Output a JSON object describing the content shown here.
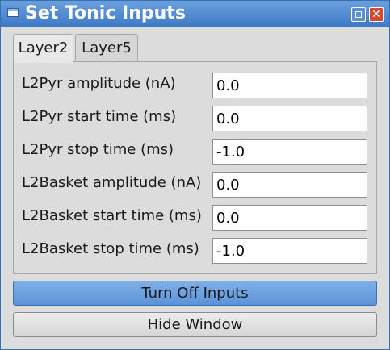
{
  "window": {
    "title": "Set Tonic Inputs"
  },
  "tabs": [
    {
      "label": "Layer2",
      "active": true
    },
    {
      "label": "Layer5",
      "active": false
    }
  ],
  "fields": [
    {
      "label": "L2Pyr amplitude (nA)",
      "value": "0.0"
    },
    {
      "label": "L2Pyr start time (ms)",
      "value": "0.0"
    },
    {
      "label": "L2Pyr stop time (ms)",
      "value": "-1.0"
    },
    {
      "label": "L2Basket amplitude (nA)",
      "value": "0.0"
    },
    {
      "label": "L2Basket start time (ms)",
      "value": "0.0"
    },
    {
      "label": "L2Basket stop time (ms)",
      "value": "-1.0"
    }
  ],
  "buttons": {
    "turn_off": "Turn Off Inputs",
    "hide": "Hide Window"
  },
  "titlebar_icons": [
    "window-icon",
    "maximize-icon",
    "close-icon"
  ],
  "colors": {
    "titlebar": "#4a86cf",
    "primary_button": "#6aa0e0",
    "close_button": "#d84a2e"
  }
}
